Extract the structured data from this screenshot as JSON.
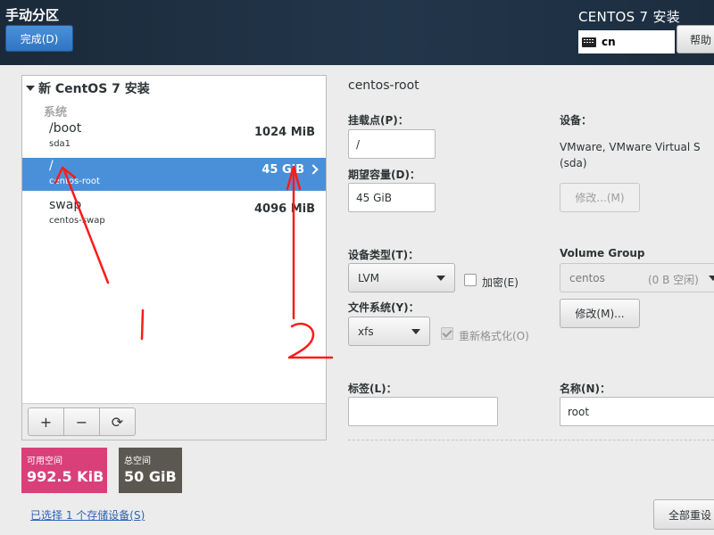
{
  "header": {
    "title": "手动分区",
    "done_label": "完成(D)",
    "install_title": "CENTOS 7 安装",
    "keyboard_layout": "cn",
    "help_label": "帮助"
  },
  "tree": {
    "header": "新 CentOS 7 安装",
    "group_label": "系统",
    "items": [
      {
        "mount": "/boot",
        "device": "sda1",
        "size": "1024 MiB",
        "selected": false
      },
      {
        "mount": "/",
        "device": "centos-root",
        "size": "45 GiB",
        "selected": true
      },
      {
        "mount": "swap",
        "device": "centos-swap",
        "size": "4096 MiB",
        "selected": false
      }
    ],
    "toolbar": {
      "add": "+",
      "remove": "−",
      "refresh": "⟳"
    }
  },
  "space": {
    "available_label": "可用空间",
    "available_value": "992.5 KiB",
    "total_label": "总空间",
    "total_value": "50 GiB"
  },
  "storage_link": "已选择 1 个存储设备(S)",
  "detail": {
    "title": "centos-root",
    "mount_point_label": "挂载点(P)：",
    "mount_point_value": "/",
    "capacity_label": "期望容量(D)：",
    "capacity_value": "45 GiB",
    "device_label": "设备：",
    "device_value_line1": "VMware, VMware Virtual S",
    "device_value_line2": "(sda)",
    "modify_device_label": "修改...(M)",
    "device_type_label": "设备类型(T)：",
    "device_type_value": "LVM",
    "encrypt_label": "加密(E)",
    "filesystem_label": "文件系统(Y)：",
    "filesystem_value": "xfs",
    "reformat_label": "重新格式化(O)",
    "volume_group_label": "Volume Group",
    "volume_group_value": "centos",
    "volume_group_free": "(0 B 空闲)",
    "modify_vg_label": "修改(M)...",
    "tag_label": "标签(L)：",
    "tag_value": "",
    "name_label": "名称(N)：",
    "name_value": "root",
    "reset_all_label": "全部重设"
  },
  "annotations": {
    "label_1": "1",
    "label_2": "2",
    "color": "#ff1a1a"
  },
  "colors": {
    "header_bg": "#1f3247",
    "accent_blue": "#4a90d9",
    "available_bg": "#d9407a",
    "total_bg": "#5a5850"
  }
}
